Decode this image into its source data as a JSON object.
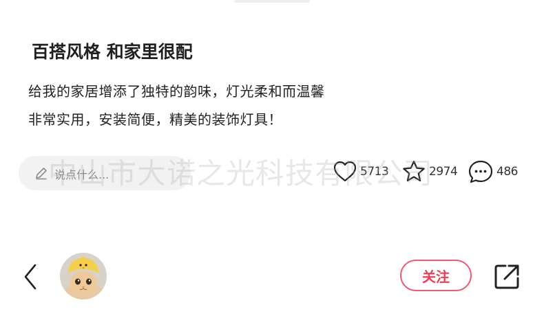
{
  "post": {
    "title": "百搭风格 和家里很配",
    "body_line_1": "给我的家居增添了独特的韵味，灯光柔和而温馨",
    "body_line_2": "非常实用，安装简便，精美的装饰灯具！"
  },
  "comment_input": {
    "placeholder": "说点什么...",
    "icon": "pencil-icon"
  },
  "stats": {
    "likes": "5713",
    "favorites": "2974",
    "comments": "486"
  },
  "watermark": "中山市大诺之光科技有限公司",
  "bottom_bar": {
    "follow_label": "关注",
    "back_icon": "chevron-left-icon",
    "share_icon": "share-icon",
    "avatar": "cat-avatar"
  },
  "colors": {
    "accent": "#ee3d55",
    "text": "#222222",
    "input_bg": "#f2f2f2"
  }
}
